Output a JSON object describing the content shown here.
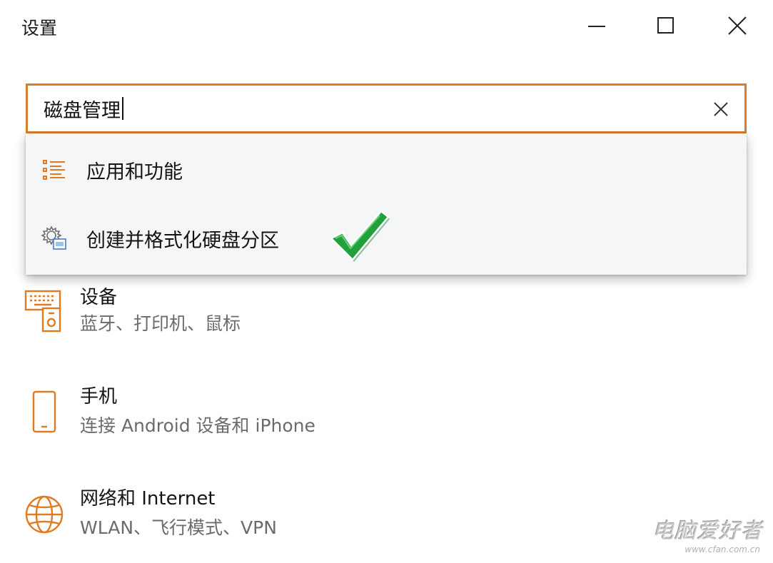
{
  "window": {
    "title": "设置",
    "minimize_icon": "minimize-icon",
    "maximize_icon": "maximize-icon",
    "close_icon": "close-icon"
  },
  "search": {
    "value": "磁盘管理",
    "clear_icon": "clear-icon",
    "accent_color": "#d97d2a"
  },
  "suggestions": [
    {
      "label": "应用和功能",
      "icon": "apps-list-icon"
    },
    {
      "label": "创建并格式化硬盘分区",
      "icon": "disk-management-icon"
    }
  ],
  "annotation": {
    "icon": "green-checkmark-icon",
    "color": "#1f9a3a"
  },
  "categories": [
    {
      "title": "设备",
      "subtitle": "蓝牙、打印机、鼠标",
      "icon": "devices-icon"
    },
    {
      "title": "手机",
      "subtitle": "连接 Android 设备和 iPhone",
      "icon": "phone-icon"
    },
    {
      "title": "网络和 Internet",
      "subtitle": "WLAN、飞行模式、VPN",
      "icon": "globe-icon"
    }
  ],
  "watermark": {
    "main": "电脑爱好者",
    "sub": "www.cfan.com.cn"
  },
  "colors": {
    "icon_orange": "#e07b22",
    "dropdown_bg": "#f5f6f8",
    "subtitle_gray": "#6b6b6b"
  }
}
